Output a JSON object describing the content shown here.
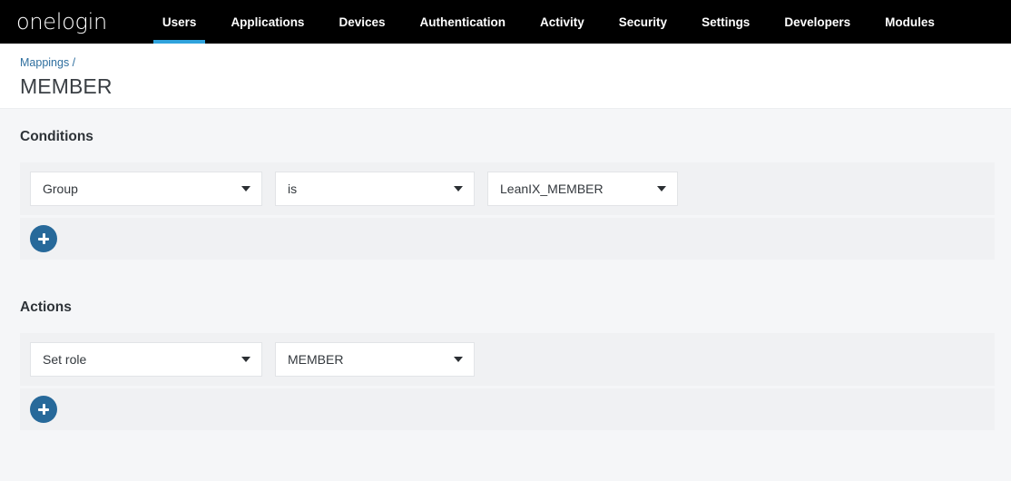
{
  "navbar": {
    "brand": "onelogin",
    "brand_icon": "onelogin-logo",
    "items": [
      {
        "label": "Users",
        "active": true
      },
      {
        "label": "Applications",
        "active": false
      },
      {
        "label": "Devices",
        "active": false
      },
      {
        "label": "Authentication",
        "active": false
      },
      {
        "label": "Activity",
        "active": false
      },
      {
        "label": "Security",
        "active": false
      },
      {
        "label": "Settings",
        "active": false
      },
      {
        "label": "Developers",
        "active": false
      },
      {
        "label": "Modules",
        "active": false
      }
    ],
    "accent_color": "#2fa3dd",
    "background_color": "#000000"
  },
  "header": {
    "breadcrumb": "Mappings /",
    "breadcrumb_parent": "Mappings",
    "title": "MEMBER"
  },
  "conditions": {
    "section_title": "Conditions",
    "rows": [
      {
        "attribute": "Group",
        "operator": "is",
        "value": "LeanIX_MEMBER"
      }
    ],
    "add_button_label": "+",
    "add_button_icon": "plus-icon"
  },
  "actions": {
    "section_title": "Actions",
    "rows": [
      {
        "action": "Set role",
        "value": "MEMBER"
      }
    ],
    "add_button_label": "+",
    "add_button_icon": "plus-icon"
  },
  "theme": {
    "page_background": "#f5f6f8",
    "row_background": "#f0f1f3",
    "field_background": "#ffffff",
    "field_border": "#e2e4e7",
    "add_button_color": "#27699a",
    "link_color": "#2f6f9f",
    "title_color": "#3a3f44"
  }
}
